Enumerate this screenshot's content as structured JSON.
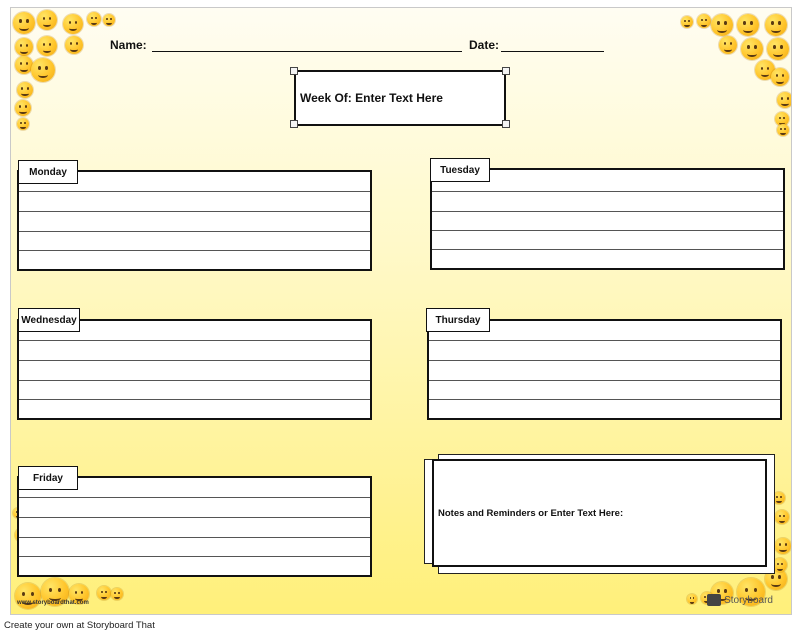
{
  "header": {
    "name_label": "Name:",
    "date_label": "Date:"
  },
  "week_box": {
    "label": "Week Of: Enter Text Here"
  },
  "days": {
    "monday": "Monday",
    "tuesday": "Tuesday",
    "wednesday": "Wednesday",
    "thursday": "Thursday",
    "friday": "Friday"
  },
  "notes": {
    "label": "Notes and Reminders or Enter Text Here:"
  },
  "watermark": {
    "url": "www.storyboardthat.com",
    "brand": "Storyboard"
  },
  "footer": {
    "text": "Create your own at Storyboard That"
  },
  "colors": {
    "background_top": "#fffdf2",
    "background_bottom": "#fff07a",
    "emoji": "#ffc52b"
  }
}
